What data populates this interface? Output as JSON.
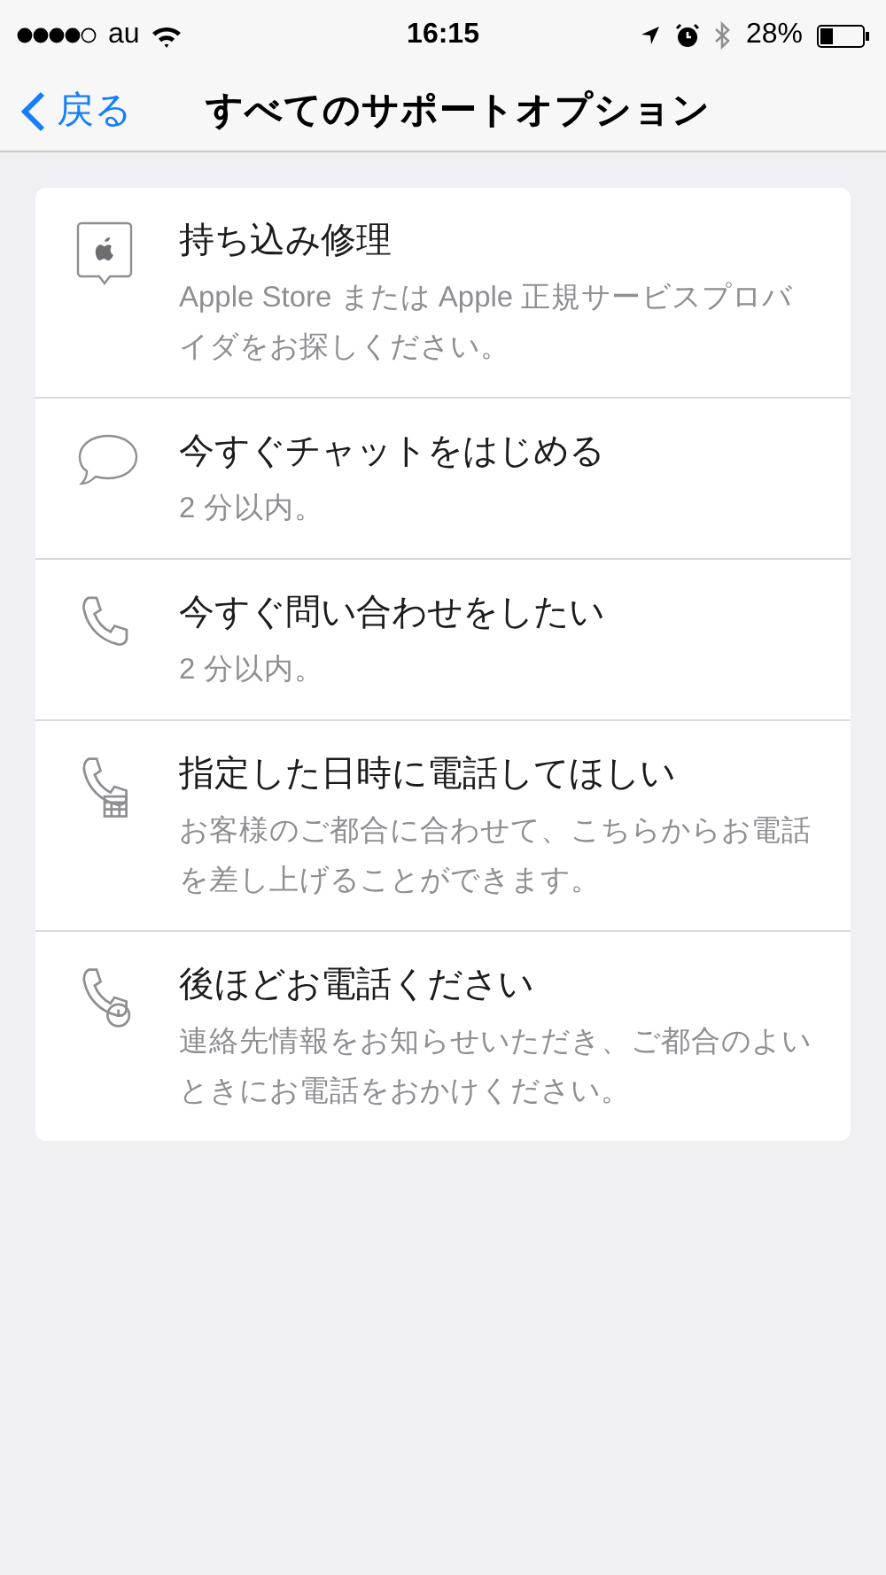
{
  "status_bar": {
    "carrier": "au",
    "time": "16:15",
    "battery": "28%"
  },
  "nav": {
    "back": "戻る",
    "title": "すべてのサポートオプション"
  },
  "options": [
    {
      "kind": "apple-store",
      "title": "持ち込み修理",
      "subtitle": "Apple Store または Apple 正規サービスプロバイダをお探しください。"
    },
    {
      "kind": "chat",
      "title": "今すぐチャットをはじめる",
      "subtitle": "2 分以内。"
    },
    {
      "kind": "phone",
      "title": "今すぐ問い合わせをしたい",
      "subtitle": "2 分以内。"
    },
    {
      "kind": "phone-calendar",
      "title": "指定した日時に電話してほしい",
      "subtitle": "お客様のご都合に合わせて、こちらからお電話を差し上げることができます。"
    },
    {
      "kind": "phone-clock",
      "title": "後ほどお電話ください",
      "subtitle": "連絡先情報をお知らせいただき、ご都合のよいときにお電話をおかけください。"
    }
  ]
}
